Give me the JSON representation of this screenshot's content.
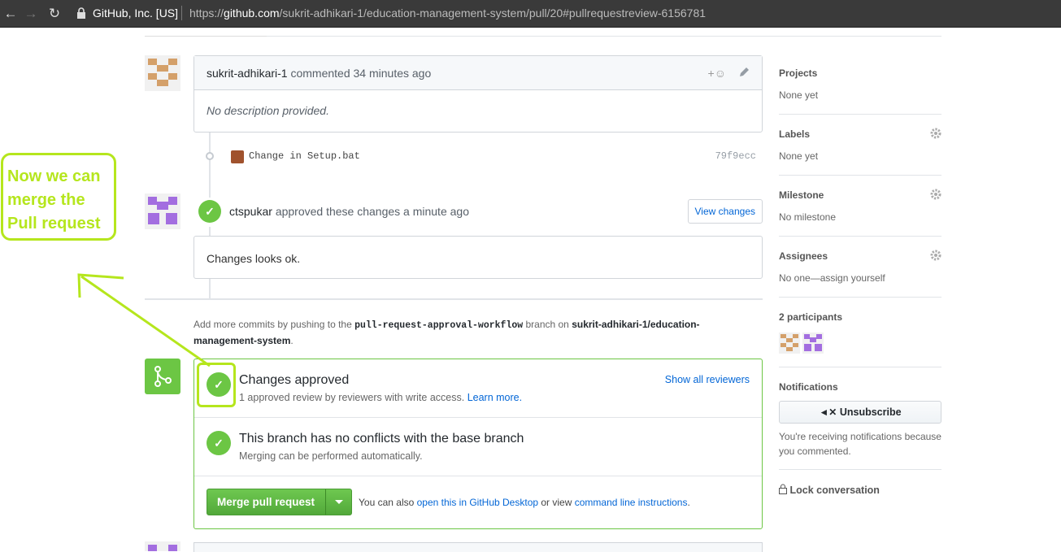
{
  "browser": {
    "org": "GitHub, Inc. [US]",
    "url_scheme": "https://",
    "url_host": "github.com",
    "url_path": "/sukrit-adhikari-1/education-management-system/pull/20#pullrequestreview-6156781"
  },
  "comment": {
    "author": "sukrit-adhikari-1",
    "action": "commented 34 minutes ago",
    "body": "No description provided.",
    "react": "+☺"
  },
  "commit": {
    "message": "Change in Setup.bat",
    "sha": "79f9ecc"
  },
  "review": {
    "author": "ctspukar",
    "action": "approved these changes a minute ago",
    "view_changes_label": "View changes",
    "body": "Changes looks ok."
  },
  "push_info": {
    "prefix": "Add more commits by pushing to the ",
    "branch": "pull-request-approval-workflow",
    "middle": " branch on ",
    "repo": "sukrit-adhikari-1/education-management-system",
    "suffix": "."
  },
  "merge": {
    "approved_title": "Changes approved",
    "approved_sub": "1 approved review by reviewers with write access.",
    "learn_more": "Learn more.",
    "show_reviewers": "Show all reviewers",
    "conflict_title": "This branch has no conflicts with the base branch",
    "conflict_sub": "Merging can be performed automatically.",
    "button_label": "Merge pull request",
    "alt_prefix": "You can also ",
    "alt_desktop": "open this in GitHub Desktop",
    "alt_mid": " or view ",
    "alt_cli": "command line instructions",
    "alt_suffix": "."
  },
  "sidebar": {
    "projects_label": "Projects",
    "projects_value": "None yet",
    "labels_label": "Labels",
    "labels_value": "None yet",
    "milestone_label": "Milestone",
    "milestone_value": "No milestone",
    "assignees_label": "Assignees",
    "assignees_value": "No one—assign yourself",
    "participants_label": "2 participants",
    "notifications_label": "Notifications",
    "unsubscribe_label": "Unsubscribe",
    "notifications_text": "You're receiving notifications because you commented.",
    "lock_label": "Lock conversation"
  },
  "annotation": {
    "text_line1": "Now we can",
    "text_line2": "merge the",
    "text_line3": "Pull request",
    "color": "#b5e61d"
  },
  "colors": {
    "success": "#6cc644",
    "link": "#0366d6",
    "avatar_orange": "#d4a06a",
    "avatar_purple": "#a36ee0"
  }
}
